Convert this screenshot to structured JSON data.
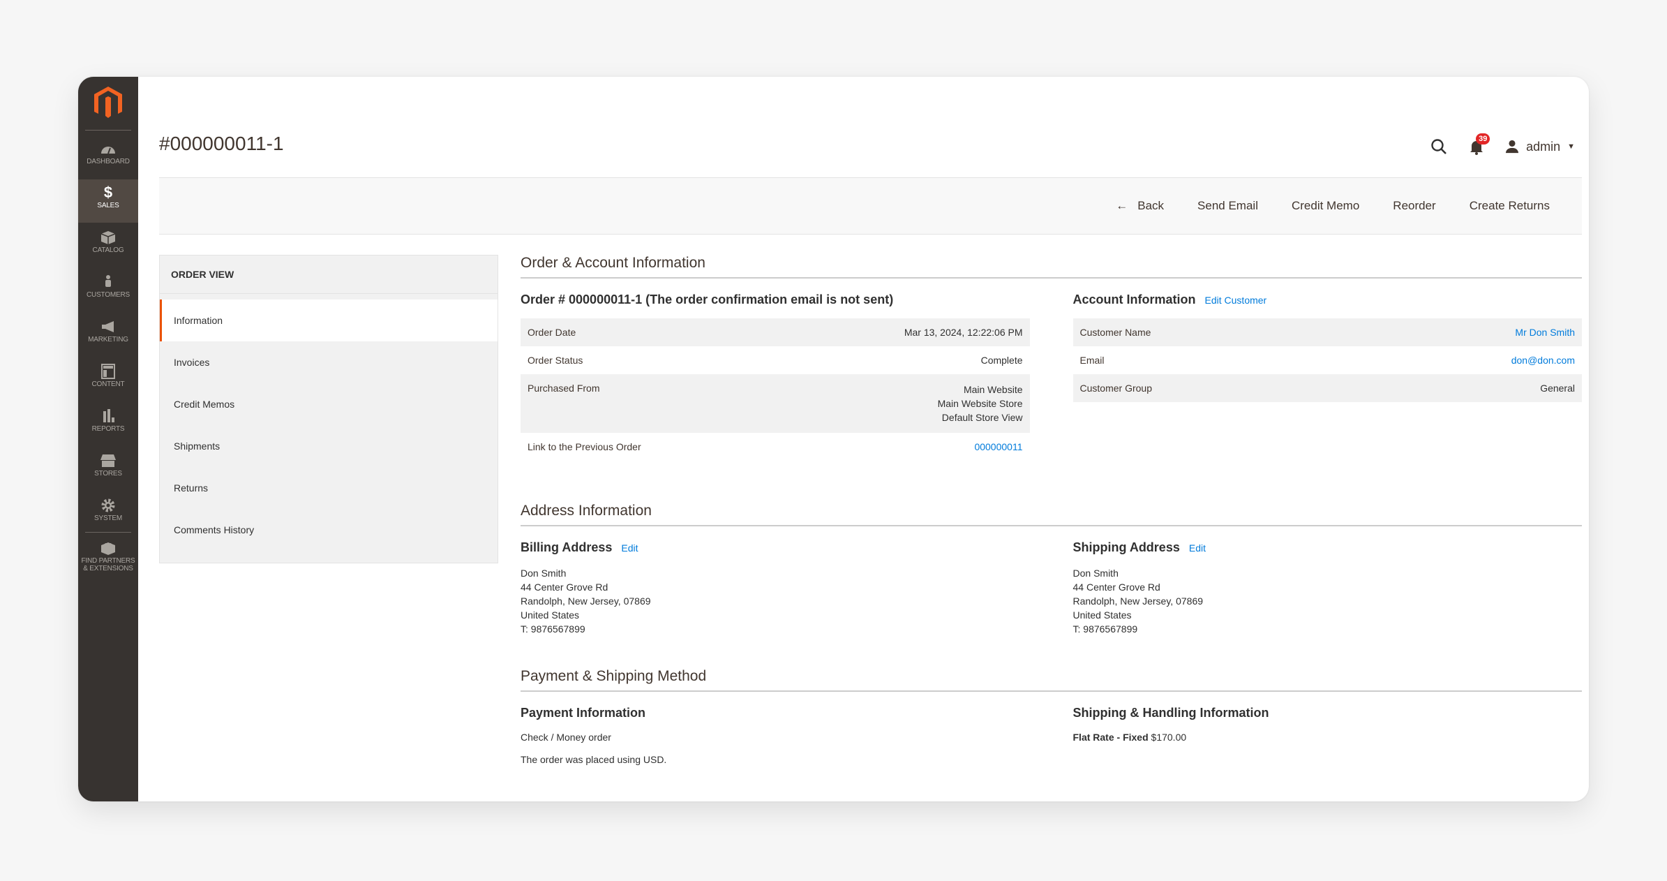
{
  "sidebar": {
    "items": [
      {
        "label": "DASHBOARD",
        "icon": "dashboard-icon"
      },
      {
        "label": "SALES",
        "icon": "dollar-icon",
        "active": true
      },
      {
        "label": "CATALOG",
        "icon": "box-icon"
      },
      {
        "label": "CUSTOMERS",
        "icon": "person-icon"
      },
      {
        "label": "MARKETING",
        "icon": "megaphone-icon"
      },
      {
        "label": "CONTENT",
        "icon": "layout-icon"
      },
      {
        "label": "REPORTS",
        "icon": "bar-chart-icon"
      },
      {
        "label": "STORES",
        "icon": "storefront-icon"
      },
      {
        "label": "SYSTEM",
        "icon": "gear-icon"
      }
    ],
    "extensions": {
      "line1": "FIND PARTNERS",
      "line2": "& EXTENSIONS"
    }
  },
  "header": {
    "title": "#000000011-1",
    "notifications_count": "39",
    "user": "admin",
    "accent": "#eb5202"
  },
  "actions": {
    "back": "Back",
    "send_email": "Send Email",
    "credit_memo": "Credit Memo",
    "reorder": "Reorder",
    "create_returns": "Create Returns"
  },
  "tabs": {
    "title": "ORDER VIEW",
    "items": [
      "Information",
      "Invoices",
      "Credit Memos",
      "Shipments",
      "Returns",
      "Comments History"
    ],
    "active": "Information"
  },
  "order_account": {
    "section_title": "Order & Account Information",
    "order": {
      "title": "Order # 000000011-1 (The order confirmation email is not sent)",
      "rows": [
        {
          "label": "Order Date",
          "value": "Mar 13, 2024, 12:22:06 PM"
        },
        {
          "label": "Order Status",
          "value": "Complete"
        },
        {
          "label": "Purchased From",
          "values": [
            "Main Website",
            "Main Website Store",
            "Default Store View"
          ]
        },
        {
          "label": "Link to the Previous Order",
          "value": "000000011"
        }
      ]
    },
    "account": {
      "title": "Account Information",
      "edit_link": "Edit Customer",
      "rows": [
        {
          "label": "Customer Name",
          "value": "Mr Don Smith"
        },
        {
          "label": "Email",
          "value": "don@don.com"
        },
        {
          "label": "Customer Group",
          "value": "General"
        }
      ]
    }
  },
  "address": {
    "section_title": "Address Information",
    "billing": {
      "title": "Billing Address",
      "edit": "Edit",
      "lines": [
        "Don Smith",
        "44 Center Grove Rd",
        "Randolph, New Jersey, 07869",
        "United States",
        "T: 9876567899"
      ]
    },
    "shipping": {
      "title": "Shipping Address",
      "edit": "Edit",
      "lines": [
        "Don Smith",
        "44 Center Grove Rd",
        "Randolph, New Jersey, 07869",
        "United States",
        "T: 9876567899"
      ]
    }
  },
  "payment_shipping": {
    "section_title": "Payment & Shipping Method",
    "payment": {
      "title": "Payment Information",
      "method": "Check / Money order",
      "note": "The order was placed using USD."
    },
    "shipping": {
      "title": "Shipping & Handling Information",
      "method": "Flat Rate - Fixed",
      "price": "$170.00"
    }
  }
}
